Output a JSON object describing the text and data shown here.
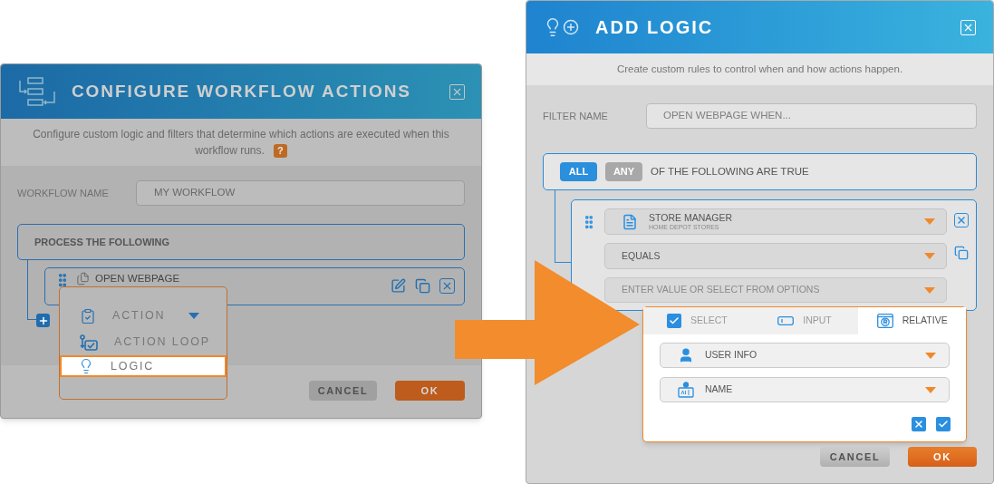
{
  "left_dialog": {
    "title": "CONFIGURE WORKFLOW ACTIONS",
    "description": "Configure custom logic and filters that determine which actions are executed when this workflow runs.",
    "help_badge": "?",
    "name_field": {
      "label": "WORKFLOW NAME",
      "value": "MY WORKFLOW"
    },
    "process": {
      "label": "PROCESS THE FOLLOWING",
      "items": [
        {
          "label": "OPEN WEBPAGE"
        }
      ]
    },
    "add_menu": {
      "items": [
        {
          "kind": "action",
          "label": "ACTION",
          "submenu": true,
          "selected": false
        },
        {
          "kind": "loop",
          "label": "ACTION LOOP",
          "submenu": false,
          "selected": false
        },
        {
          "kind": "logic",
          "label": "LOGIC",
          "submenu": false,
          "selected": true
        }
      ]
    },
    "buttons": [
      {
        "kind": "cancel",
        "label": "CANCEL"
      },
      {
        "kind": "ok",
        "label": "OK"
      }
    ]
  },
  "right_dialog": {
    "title": "ADD LOGIC",
    "description": "Create custom rules to control when and how actions happen.",
    "filter_field": {
      "label": "FILTER NAME",
      "value": "OPEN WEBPAGE WHEN..."
    },
    "match": {
      "options": [
        {
          "label": "ALL",
          "selected": true
        },
        {
          "label": "ANY",
          "selected": false
        }
      ],
      "text": "OF THE FOLLOWING ARE TRUE"
    },
    "condition": {
      "field": {
        "label": "STORE MANAGER",
        "sublabel": "HOME DEPOT STORES"
      },
      "operator": "EQUALS",
      "value_placeholder": "ENTER VALUE OR SELECT FROM OPTIONS"
    },
    "value_popup": {
      "tabs": [
        {
          "kind": "select",
          "label": "SELECT",
          "selected": false
        },
        {
          "kind": "input",
          "label": "INPUT",
          "selected": false
        },
        {
          "kind": "relative",
          "label": "RELATIVE",
          "selected": true
        }
      ],
      "selects": [
        {
          "kind": "user",
          "label": "USER INFO"
        },
        {
          "kind": "name",
          "label": "NAME"
        }
      ]
    },
    "buttons": [
      {
        "kind": "cancel",
        "label": "CANCEL"
      },
      {
        "kind": "ok",
        "label": "OK"
      }
    ]
  }
}
